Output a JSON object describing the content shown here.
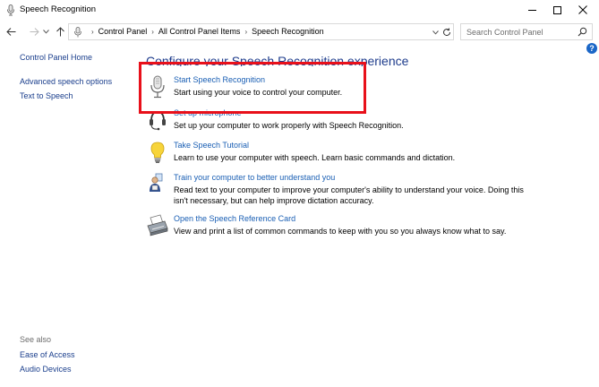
{
  "window": {
    "title": "Speech Recognition"
  },
  "address": {
    "crumbs": [
      "Control Panel",
      "All Control Panel Items",
      "Speech Recognition"
    ]
  },
  "search": {
    "placeholder": "Search Control Panel"
  },
  "sidebar": {
    "home": "Control Panel Home",
    "items": [
      "Advanced speech options",
      "Text to Speech"
    ],
    "see_also_label": "See also",
    "see_also": [
      "Ease of Access",
      "Audio Devices"
    ]
  },
  "main": {
    "heading": "Configure your Speech Recognition experience",
    "tasks": [
      {
        "link": "Start Speech Recognition",
        "desc": [
          "Start using your voice to control your computer."
        ],
        "icon": "microphone-icon"
      },
      {
        "link": "Set up microphone",
        "desc": [
          "Set up your computer to work properly with Speech Recognition."
        ],
        "icon": "headset-icon"
      },
      {
        "link": "Take Speech Tutorial",
        "desc": [
          "Learn to use your computer with speech.  Learn basic commands and dictation."
        ],
        "icon": "lightbulb-icon"
      },
      {
        "link": "Train your computer to better understand you",
        "desc": [
          "Read text to your computer to improve your computer's ability to understand your voice.  Doing this",
          "isn't necessary, but can help improve dictation accuracy."
        ],
        "icon": "person-training-icon"
      },
      {
        "link": "Open the Speech Reference Card",
        "desc": [
          "View and print a list of common commands to keep with you so you always know what to say."
        ],
        "icon": "printer-icon"
      }
    ]
  },
  "colors": {
    "link": "#1a5fb4",
    "heading": "#1e3c8c",
    "highlight": "#e8101a",
    "help": "#1a66c7"
  }
}
